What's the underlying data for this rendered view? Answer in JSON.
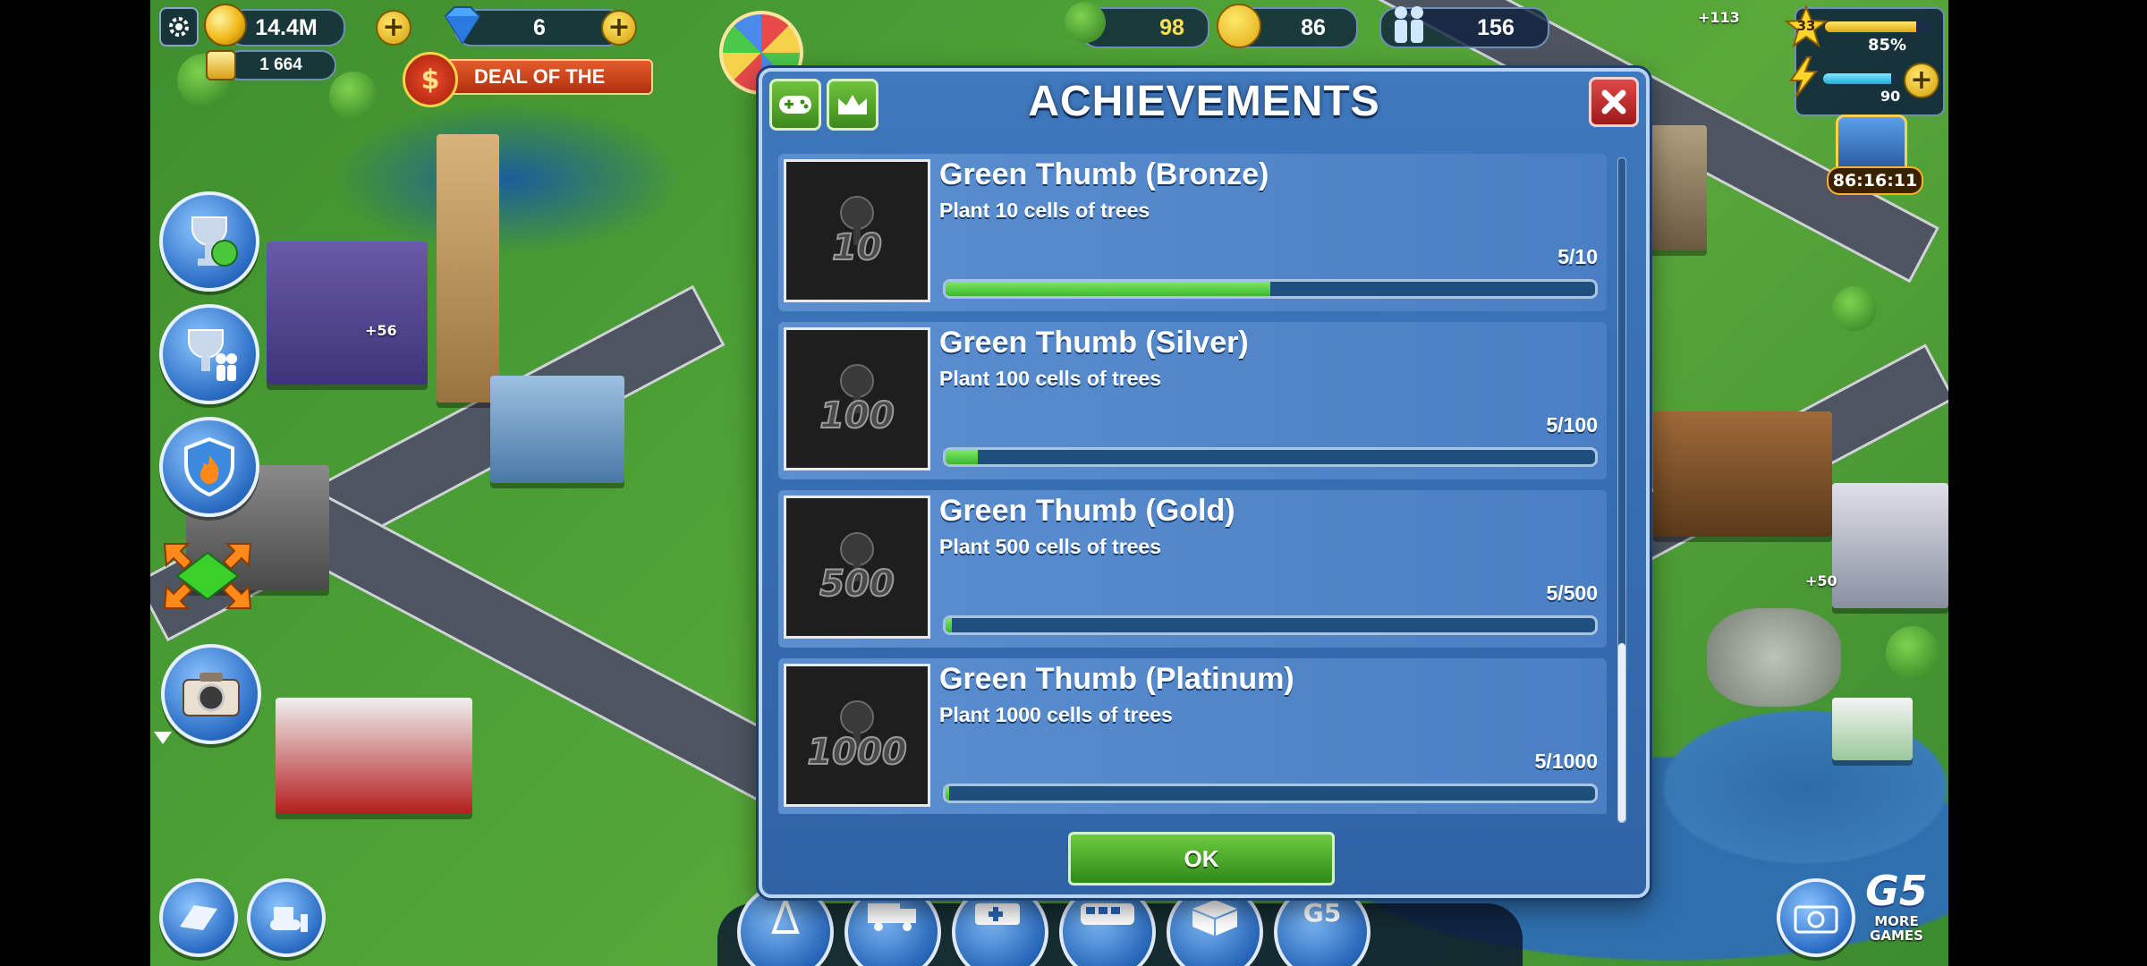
{
  "hud": {
    "coins": "14.4M",
    "gems": "6",
    "gold_bars": "1 664",
    "deal_banner": "DEAL OF THE",
    "trees": "98",
    "happiness": "86",
    "population": "156",
    "level": "33",
    "xp_percent": "85%",
    "xp_fill": 0.85,
    "energy": "90",
    "chest_timer": "86:16:11",
    "income_top": "+113",
    "income_left": "+56",
    "income_right": "+50"
  },
  "dialog": {
    "title": "ACHIEVEMENTS",
    "ok_label": "OK",
    "items": [
      {
        "title": "Green Thumb (Bronze)",
        "description": "Plant 10 cells of trees",
        "badge": "10",
        "count": "5/10",
        "progress": 0.5
      },
      {
        "title": "Green Thumb (Silver)",
        "description": "Plant 100 cells of trees",
        "badge": "100",
        "count": "5/100",
        "progress": 0.05
      },
      {
        "title": "Green Thumb (Gold)",
        "description": "Plant 500 cells of trees",
        "badge": "500",
        "count": "5/500",
        "progress": 0.01
      },
      {
        "title": "Green Thumb (Platinum)",
        "description": "Plant 1000 cells of trees",
        "badge": "1000",
        "count": "5/1000",
        "progress": 0.005
      }
    ]
  },
  "brand": {
    "logo": "G5",
    "more_games": "MORE GAMES"
  },
  "icons": {
    "settings": "gear-icon",
    "coins": "coin-stack-icon",
    "gems": "diamond-icon",
    "trees": "tree-icon",
    "happiness": "smiley-icon",
    "population": "people-icon",
    "level": "star-icon",
    "energy": "lightning-icon"
  },
  "colors": {
    "dialog_bg": "#3f78bd",
    "progress_fill": "#3cb82c",
    "ok_button": "#2f8a1a",
    "close_button": "#c03030"
  }
}
